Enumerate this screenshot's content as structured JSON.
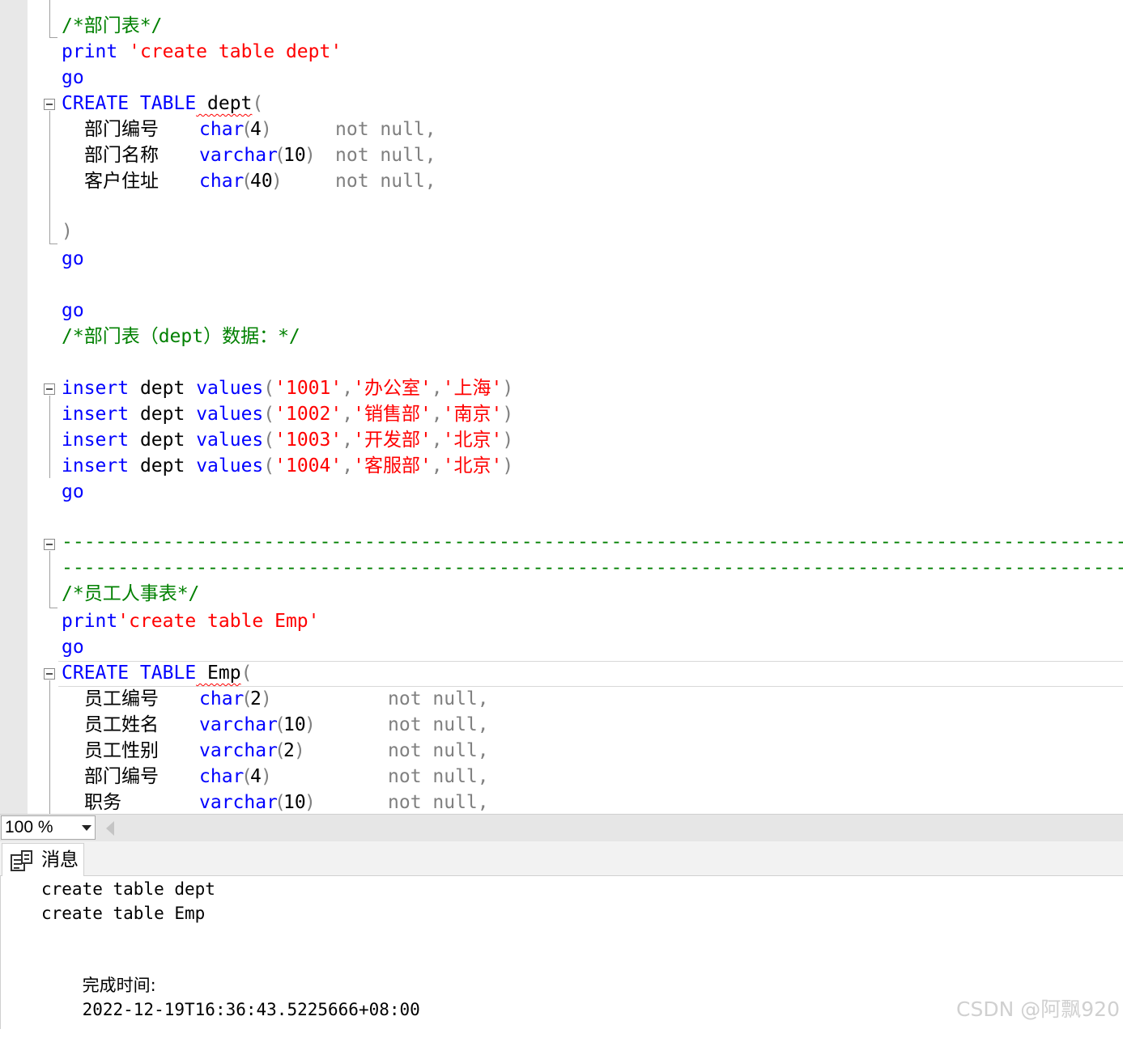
{
  "editor": {
    "lines": [
      {
        "tokens": [
          [
            "/*部门表*/",
            "cmt"
          ]
        ]
      },
      {
        "tokens": [
          [
            "print",
            "kw"
          ],
          [
            " 'create table dept'",
            "str"
          ]
        ]
      },
      {
        "tokens": [
          [
            "go",
            "kw"
          ]
        ]
      },
      {
        "tokens": [
          [
            "CREATE TABLE",
            "kw"
          ],
          [
            " dept",
            "plain squiggle"
          ],
          [
            "(",
            "gray"
          ]
        ]
      },
      {
        "tokens": [
          [
            "部门编号",
            "plain",
            28
          ],
          [
            "char",
            "kw",
            170
          ],
          [
            "(",
            "gray",
            222
          ],
          [
            "4",
            "plain",
            233
          ],
          [
            ")",
            "gray",
            246
          ],
          [
            "not null,",
            "gray",
            338
          ]
        ]
      },
      {
        "tokens": [
          [
            "部门名称",
            "plain",
            28
          ],
          [
            "varchar",
            "kw",
            170
          ],
          [
            "(",
            "gray",
            263
          ],
          [
            "10",
            "plain",
            274
          ],
          [
            ")",
            "gray",
            300
          ],
          [
            "not null,",
            "gray",
            338
          ]
        ]
      },
      {
        "tokens": [
          [
            "客户住址",
            "plain",
            28
          ],
          [
            "char",
            "kw",
            170
          ],
          [
            "(",
            "gray",
            222
          ],
          [
            "40",
            "plain",
            233
          ],
          [
            ")",
            "gray",
            259
          ],
          [
            "not null,",
            "gray",
            338
          ]
        ]
      },
      {
        "tokens": [
          [
            ")",
            "gray"
          ]
        ]
      },
      {
        "tokens": [
          [
            "go",
            "kw"
          ]
        ]
      },
      {
        "tokens": [
          [
            "go",
            "kw"
          ]
        ]
      },
      {
        "tokens": [
          [
            "/*部门表（dept）数据：*/",
            "cmt"
          ]
        ]
      },
      {
        "tokens": [
          [
            "insert",
            "kw"
          ],
          [
            " dept ",
            "plain"
          ],
          [
            "values",
            "kw"
          ],
          [
            "(",
            "gray"
          ],
          [
            "'1001'",
            "str"
          ],
          [
            ",",
            "gray"
          ],
          [
            "'办公室'",
            "str"
          ],
          [
            ",",
            "gray"
          ],
          [
            "'上海'",
            "str"
          ],
          [
            ")",
            "gray"
          ]
        ]
      },
      {
        "tokens": [
          [
            "insert",
            "kw"
          ],
          [
            " dept ",
            "plain"
          ],
          [
            "values",
            "kw"
          ],
          [
            "(",
            "gray"
          ],
          [
            "'1002'",
            "str"
          ],
          [
            ",",
            "gray"
          ],
          [
            "'销售部'",
            "str"
          ],
          [
            ",",
            "gray"
          ],
          [
            "'南京'",
            "str"
          ],
          [
            ")",
            "gray"
          ]
        ]
      },
      {
        "tokens": [
          [
            "insert",
            "kw"
          ],
          [
            " dept ",
            "plain"
          ],
          [
            "values",
            "kw"
          ],
          [
            "(",
            "gray"
          ],
          [
            "'1003'",
            "str"
          ],
          [
            ",",
            "gray"
          ],
          [
            "'开发部'",
            "str"
          ],
          [
            ",",
            "gray"
          ],
          [
            "'北京'",
            "str"
          ],
          [
            ")",
            "gray"
          ]
        ]
      },
      {
        "tokens": [
          [
            "insert",
            "kw"
          ],
          [
            " dept ",
            "plain"
          ],
          [
            "values",
            "kw"
          ],
          [
            "(",
            "gray"
          ],
          [
            "'1004'",
            "str"
          ],
          [
            ",",
            "gray"
          ],
          [
            "'客服部'",
            "str"
          ],
          [
            ",",
            "gray"
          ],
          [
            "'北京'",
            "str"
          ],
          [
            ")",
            "gray"
          ]
        ]
      },
      {
        "tokens": [
          [
            "go",
            "kw"
          ]
        ]
      },
      {
        "tokens": [
          [
            "---------------------------------------------------------------------------------------------------------------------------------",
            "cmt"
          ]
        ]
      },
      {
        "tokens": [
          [
            "---------------------------------------------------------------------------------------------------------------------------------",
            "cmt"
          ]
        ]
      },
      {
        "tokens": [
          [
            "/*员工人事表*/",
            "cmt"
          ]
        ]
      },
      {
        "tokens": [
          [
            "print",
            "kw"
          ],
          [
            "'create table Emp'",
            "str"
          ]
        ]
      },
      {
        "tokens": [
          [
            "go",
            "kw"
          ]
        ]
      },
      {
        "tokens": [
          [
            "CREATE TABLE",
            "kw"
          ],
          [
            " Emp",
            "plain squiggle"
          ],
          [
            "(",
            "gray"
          ]
        ]
      },
      {
        "tokens": [
          [
            "员工编号",
            "plain",
            28
          ],
          [
            "char",
            "kw",
            170
          ],
          [
            "(",
            "gray",
            222
          ],
          [
            "2",
            "plain",
            233
          ],
          [
            ")",
            "gray",
            246
          ],
          [
            "not null,",
            "gray",
            403
          ]
        ]
      },
      {
        "tokens": [
          [
            "员工姓名",
            "plain",
            28
          ],
          [
            "varchar",
            "kw",
            170
          ],
          [
            "(",
            "gray",
            263
          ],
          [
            "10",
            "plain",
            274
          ],
          [
            ")",
            "gray",
            300
          ],
          [
            "not null,",
            "gray",
            403
          ]
        ]
      },
      {
        "tokens": [
          [
            "员工性别",
            "plain",
            28
          ],
          [
            "varchar",
            "kw",
            170
          ],
          [
            "(",
            "gray",
            263
          ],
          [
            "2",
            "plain",
            274
          ],
          [
            ")",
            "gray",
            287
          ],
          [
            "not null,",
            "gray",
            403
          ]
        ]
      },
      {
        "tokens": [
          [
            "部门编号",
            "plain",
            28
          ],
          [
            "char",
            "kw",
            170
          ],
          [
            "(",
            "gray",
            222
          ],
          [
            "4",
            "plain",
            233
          ],
          [
            ")",
            "gray",
            246
          ],
          [
            "not null,",
            "gray",
            403
          ]
        ]
      },
      {
        "tokens": [
          [
            "职务",
            "plain",
            28
          ],
          [
            "varchar",
            "kw",
            170
          ],
          [
            "(",
            "gray",
            263
          ],
          [
            "10",
            "plain",
            274
          ],
          [
            ")",
            "gray",
            300
          ],
          [
            "not null,",
            "gray",
            403
          ]
        ]
      }
    ]
  },
  "zoom": {
    "value": "100 %"
  },
  "results": {
    "tab_label": "消息",
    "messages": [
      "create table dept",
      "create table Emp"
    ],
    "completion_label": "完成时间:",
    "completion_time": "2022-12-19T16:36:43.5225666+08:00"
  },
  "watermark": "CSDN @阿飘920",
  "colors": {
    "keyword": "#0000ff",
    "string": "#ff0000",
    "comment": "#008000",
    "punct": "#808080",
    "gutter": "#e8e8e8"
  }
}
